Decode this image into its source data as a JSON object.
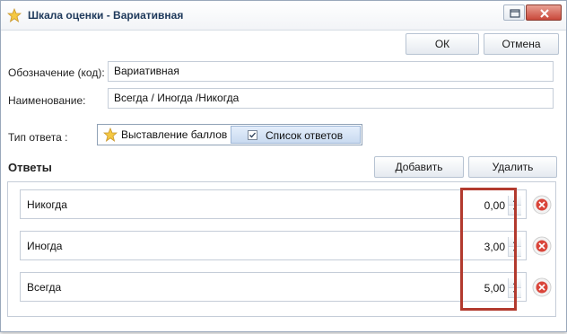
{
  "window": {
    "title": "Шкала оценки - Вариативная",
    "icons": {
      "app": "star-icon",
      "restore": "restore-icon",
      "close": "close-icon"
    }
  },
  "toolbar": {
    "ok_label": "ОК",
    "cancel_label": "Отмена"
  },
  "form": {
    "code_label": "Обозначение (код):",
    "code_value": "Вариативная",
    "name_label": "Наименование:",
    "name_value": "Всегда / Иногда /Никогда"
  },
  "answer_type": {
    "label": "Тип ответа :",
    "options": [
      {
        "label": "Выставление баллов",
        "icon": "star-icon",
        "selected": false
      },
      {
        "label": "Список ответов",
        "icon": "checkbox-icon",
        "selected": true
      }
    ]
  },
  "answers": {
    "title": "Ответы",
    "add_label": "Добавить",
    "delete_label": "Удалить",
    "items": [
      {
        "label": "Никогда",
        "value": "0,00"
      },
      {
        "label": "Иногда",
        "value": "3,00"
      },
      {
        "label": "Всегда",
        "value": "5,00"
      }
    ]
  },
  "colors": {
    "highlight": "#b23a2e",
    "delete_icon": "#d9453a",
    "title_text": "#1e395b"
  }
}
